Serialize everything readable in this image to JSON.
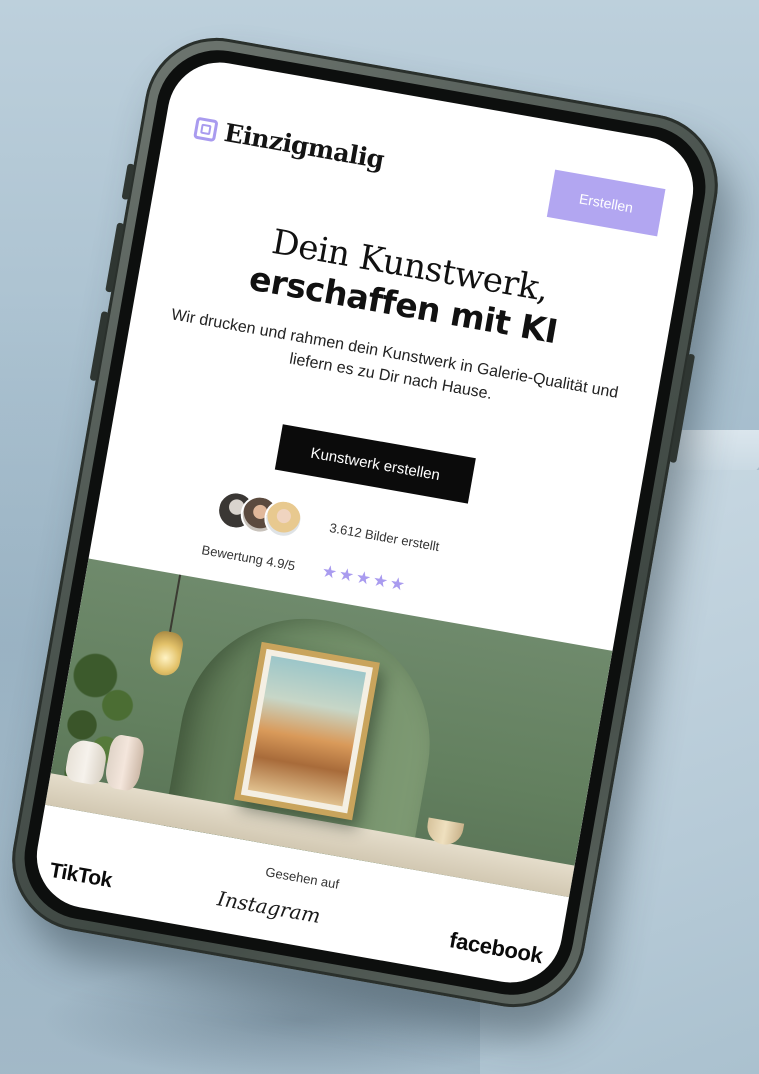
{
  "header": {
    "brand": "Einzigmalig",
    "cta_label": "Erstellen"
  },
  "hero": {
    "headline_line1": "Dein Kunstwerk,",
    "headline_line2": "erschaffen mit KI",
    "subtext": "Wir drucken und rahmen dein Kunstwerk in Galerie-Qualität und liefern es zu Dir nach Hause.",
    "cta_label": "Kunstwerk erstellen"
  },
  "social_proof": {
    "count_text": "3.612 Bilder erstellt",
    "rating_text": "Bewertung 4.9/5",
    "stars": "★★★★★",
    "rating_value": 4.9,
    "rating_max": 5
  },
  "press": {
    "label": "Gesehen auf",
    "brands": [
      "TikTok",
      "Instagram",
      "facebook"
    ]
  },
  "colors": {
    "accent": "#b2a6f1",
    "primary_button": "#0b0b0b"
  }
}
